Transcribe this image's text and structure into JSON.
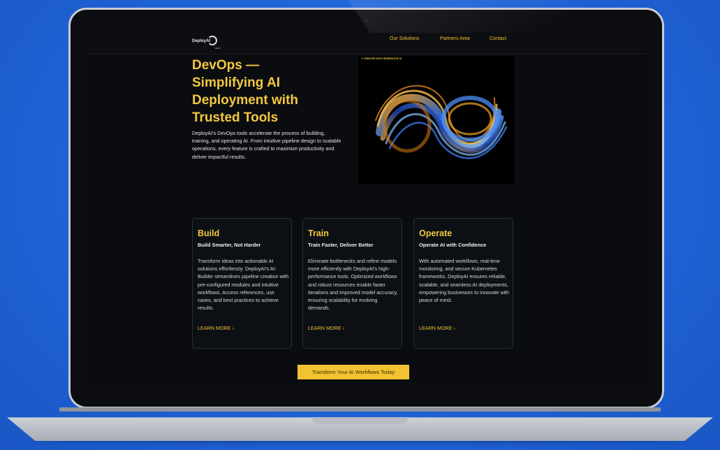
{
  "nav": {
    "logo_text": "DeployAI",
    "logo_badge": "BETA",
    "links": [
      "Our Solutions",
      "Partners Area",
      "Contact"
    ]
  },
  "hero": {
    "title_lines": [
      "DevOps —",
      "Simplifying AI",
      "Deployment with",
      "Trusted Tools"
    ],
    "description": "DeployAI's DevOps tools accelerate the process of building, training, and operating AI. From intuitive pipeline design to scalable operations, every feature is crafted to maximize productivity and deliver impactful results.",
    "image_badge": "✦ CREATED WITH GENERATIVE AI"
  },
  "cards": [
    {
      "title": "Build",
      "subtitle": "Build Smarter, Not Harder",
      "body": "Transform ideas into actionable AI solutions effortlessly. DeployAI's AI-Builder streamlines pipeline creation with pre-configured modules and intuitive workflows. Access references, use cases, and best practices to achieve results.",
      "link": "LEARN MORE ›"
    },
    {
      "title": "Train",
      "subtitle": "Train Faster, Deliver Better",
      "body": "Eliminate bottlenecks and refine models more efficiently with DeployAI's high-performance tools. Optimized workflows and robust resources enable faster iterations and improved model accuracy, ensuring scalability for evolving demands.",
      "link": "LEARN MORE ›"
    },
    {
      "title": "Operate",
      "subtitle": "Operate AI with Confidence",
      "body": "With automated workflows, real-time monitoring, and secure Kubernetes frameworks, DeployAI ensures reliable, scalable, and seamless AI deployments, empowering businesses to innovate with peace of mind.",
      "link": "LEARN MORE ›"
    }
  ],
  "cta": {
    "label": "Transform Your AI Workflows Today"
  },
  "colors": {
    "accent": "#f2c231",
    "background": "#0a0c10",
    "page_bg": "#1f63d6"
  }
}
